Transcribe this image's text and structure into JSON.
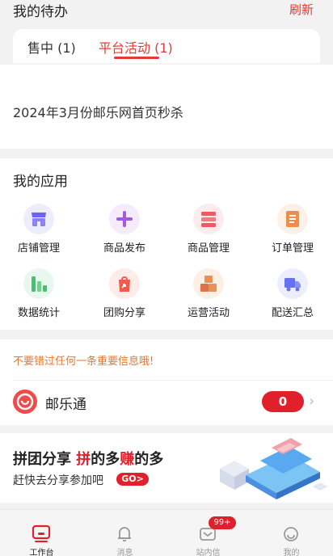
{
  "todo": {
    "title": "我的待办",
    "refresh_label": "刷新",
    "tabs": [
      {
        "label": "售中 (1)",
        "active": false
      },
      {
        "label": "平台活动 (1)",
        "active": true
      }
    ],
    "items": [
      "2024年3月份邮乐网首页秒杀"
    ]
  },
  "apps": {
    "title": "我的应用",
    "items": [
      {
        "label": "店铺管理",
        "icon": "store-icon",
        "color": "#6a63f6"
      },
      {
        "label": "商品发布",
        "icon": "plus-icon",
        "color": "#a259e6"
      },
      {
        "label": "商品管理",
        "icon": "list-icon",
        "color": "#ee5a62"
      },
      {
        "label": "订单管理",
        "icon": "order-icon",
        "color": "#f28c4a"
      },
      {
        "label": "数据统计",
        "icon": "bar-chart-icon",
        "color": "#45c06b"
      },
      {
        "label": "团购分享",
        "icon": "share-bag-icon",
        "color": "#f25a4a"
      },
      {
        "label": "运营活动",
        "icon": "boxes-icon",
        "color": "#e7905a"
      },
      {
        "label": "配送汇总",
        "icon": "truck-icon",
        "color": "#6570f2"
      }
    ]
  },
  "notice": {
    "text": "不要错过任何一条重要信息哦!",
    "service_name": "邮乐通",
    "unread_count": "0"
  },
  "banner": {
    "title_part1": "拼团分享",
    "title_part2": "拼",
    "title_part3": "的多",
    "title_part4": "赚",
    "title_part5": "的多",
    "subtitle": "赶快去分享参加吧",
    "go_label": "GO>"
  },
  "bottom_nav": {
    "items": [
      {
        "label": "工作台",
        "icon": "workbench-icon",
        "active": true
      },
      {
        "label": "消息",
        "icon": "bell-icon",
        "active": false
      },
      {
        "label": "站内信",
        "icon": "mail-icon",
        "active": false,
        "badge": "99+"
      },
      {
        "label": "我的",
        "icon": "smile-icon",
        "active": false
      }
    ]
  },
  "colors": {
    "accent_red": "#e0202a",
    "notice_orange": "#e8772e"
  }
}
